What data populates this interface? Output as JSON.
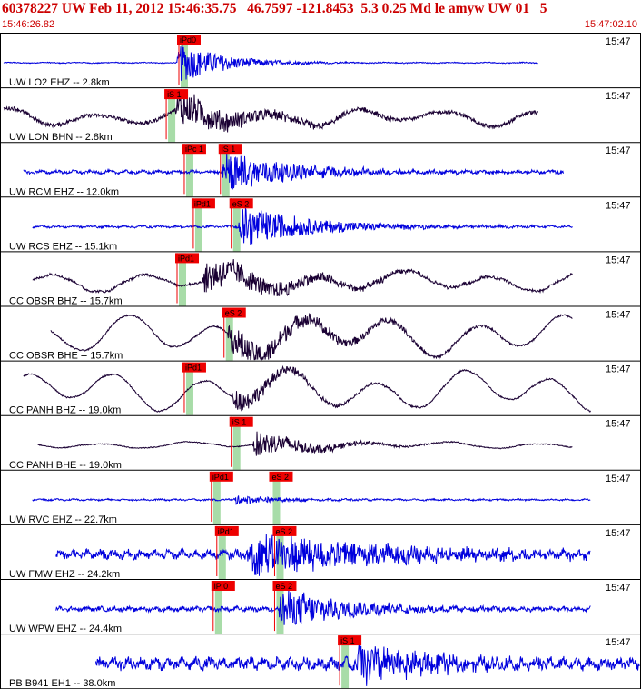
{
  "header": {
    "title": "60378227 UW Feb 11, 2012 15:46:35.75   46.7597 -121.8453  5.3 0.25 Md le amyw UW 01   5",
    "start_time": "15:46:26.82",
    "end_time": "15:47:02.10"
  },
  "colors": {
    "header_red": "#cc0000",
    "trace_blue": "#0000dd",
    "trace_dark": "#1a0033",
    "pick_box": "#ee0000",
    "window_green": "#a8dca8",
    "divider": "#000000"
  },
  "chart_data": {
    "type": "line",
    "title": "60378227 UW Feb 11, 2012 15:46:35.75   46.7597 -121.8453  5.3 0.25 Md le amyw UW 01   5",
    "x_unit": "time (UTC)",
    "x_range": [
      "15:46:26.82",
      "15:47:02.10"
    ],
    "panel_time_label": "15:47",
    "series": [
      {
        "label": "UW LO2 EHZ -- 2.8km",
        "color": "#0000dd",
        "trace_start_s": 0.1,
        "trace_end_s": 29.7,
        "picks": [
          {
            "label": "iPd0",
            "t": 9.8
          }
        ],
        "arrival_s": 9.7,
        "amp_pre": 0.02,
        "amp_event": 0.9,
        "decay": 2.5,
        "noise_period": 0.3,
        "long_period": 0
      },
      {
        "label": "UW LON BHN -- 2.8km",
        "color": "#1a0033",
        "trace_start_s": 0.1,
        "trace_end_s": 29.7,
        "picks": [
          {
            "label": "iS 1",
            "t": 9.1
          }
        ],
        "arrival_s": 9.6,
        "amp_pre": 0.08,
        "amp_event": 0.8,
        "decay": 4,
        "noise_period": 0.5,
        "long_period": 0.25
      },
      {
        "label": "UW RCM EHZ -- 12.0km",
        "color": "#0000dd",
        "trace_start_s": 1.2,
        "trace_end_s": 31.1,
        "picks": [
          {
            "label": "iPc 1",
            "t": 10.1
          },
          {
            "label": "iS 1",
            "t": 12.1
          }
        ],
        "arrival_s": 12.2,
        "amp_pre": 0.06,
        "amp_event": 0.9,
        "decay": 4,
        "noise_period": 0.15,
        "long_period": 0
      },
      {
        "label": "UW RCS EHZ -- 15.1km",
        "color": "#0000dd",
        "trace_start_s": 1.7,
        "trace_end_s": 31.6,
        "picks": [
          {
            "label": "iPd1",
            "t": 10.6
          },
          {
            "label": "eS 2",
            "t": 12.7
          }
        ],
        "arrival_s": 13.1,
        "amp_pre": 0.04,
        "amp_event": 0.9,
        "decay": 4,
        "noise_period": 0.15,
        "long_period": 0
      },
      {
        "label": "CC OBSR BHZ -- 15.7km",
        "color": "#1a0033",
        "trace_start_s": 1.7,
        "trace_end_s": 31.6,
        "picks": [
          {
            "label": "iPd1",
            "t": 9.7
          }
        ],
        "arrival_s": 11.1,
        "amp_pre": 0.05,
        "amp_event": 0.7,
        "decay": 5,
        "noise_period": 0.2,
        "long_period": 0.3
      },
      {
        "label": "CC OBSR BHE -- 15.7km",
        "color": "#1a0033",
        "trace_start_s": 2.7,
        "trace_end_s": 31.6,
        "picks": [
          {
            "label": "eS 2",
            "t": 12.3
          }
        ],
        "arrival_s": 12.5,
        "amp_pre": 0.03,
        "amp_event": 0.7,
        "decay": 5,
        "noise_period": 0.3,
        "long_period": 0.6
      },
      {
        "label": "CC PANH BHZ -- 19.0km",
        "color": "#1a0033",
        "trace_start_s": 1.2,
        "trace_end_s": 32.6,
        "picks": [
          {
            "label": "iPd1",
            "t": 10.1
          }
        ],
        "arrival_s": 12.7,
        "amp_pre": 0.03,
        "amp_event": 0.5,
        "decay": 3,
        "noise_period": 0.2,
        "long_period": 0.6
      },
      {
        "label": "CC PANH BHE -- 19.0km",
        "color": "#1a0033",
        "trace_start_s": 2.0,
        "trace_end_s": 31.6,
        "picks": [
          {
            "label": "iS 1",
            "t": 12.7
          }
        ],
        "arrival_s": 13.9,
        "amp_pre": 0.02,
        "amp_event": 0.6,
        "decay": 3,
        "noise_period": 0.3,
        "long_period": 0.1
      },
      {
        "label": "UW RVC EHZ -- 22.7km",
        "color": "#0000dd",
        "trace_start_s": 1.7,
        "trace_end_s": 32.6,
        "picks": [
          {
            "label": "iPd1",
            "t": 11.6
          },
          {
            "label": "eS 2",
            "t": 14.9
          }
        ],
        "arrival_s": 12.8,
        "amp_pre": 0.03,
        "amp_event": 0.2,
        "decay": 3,
        "noise_period": 0.15,
        "long_period": 0
      },
      {
        "label": "UW FMW EHZ -- 24.2km",
        "color": "#0000dd",
        "trace_start_s": 3.0,
        "trace_end_s": 32.6,
        "picks": [
          {
            "label": "iPd1",
            "t": 11.9
          },
          {
            "label": "eS 2",
            "t": 15.1
          }
        ],
        "arrival_s": 13.5,
        "amp_pre": 0.15,
        "amp_event": 0.9,
        "decay": 8,
        "noise_period": 0.12,
        "long_period": 0
      },
      {
        "label": "UW WPW EHZ -- 24.4km",
        "color": "#0000dd",
        "trace_start_s": 3.0,
        "trace_end_s": 32.6,
        "picks": [
          {
            "label": "iP 0",
            "t": 11.7
          },
          {
            "label": "eS 2",
            "t": 15.1
          }
        ],
        "arrival_s": 15.3,
        "amp_pre": 0.08,
        "amp_event": 0.9,
        "decay": 4,
        "noise_period": 0.12,
        "long_period": 0
      },
      {
        "label": "PB B941 EH1 -- 38.0km",
        "color": "#0000dd",
        "trace_start_s": 5.2,
        "trace_end_s": 35.3,
        "picks": [
          {
            "label": "iS 1",
            "t": 18.7
          }
        ],
        "arrival_s": 19.6,
        "amp_pre": 0.2,
        "amp_event": 0.9,
        "decay": 4,
        "noise_period": 0.12,
        "long_period": 0
      }
    ]
  }
}
